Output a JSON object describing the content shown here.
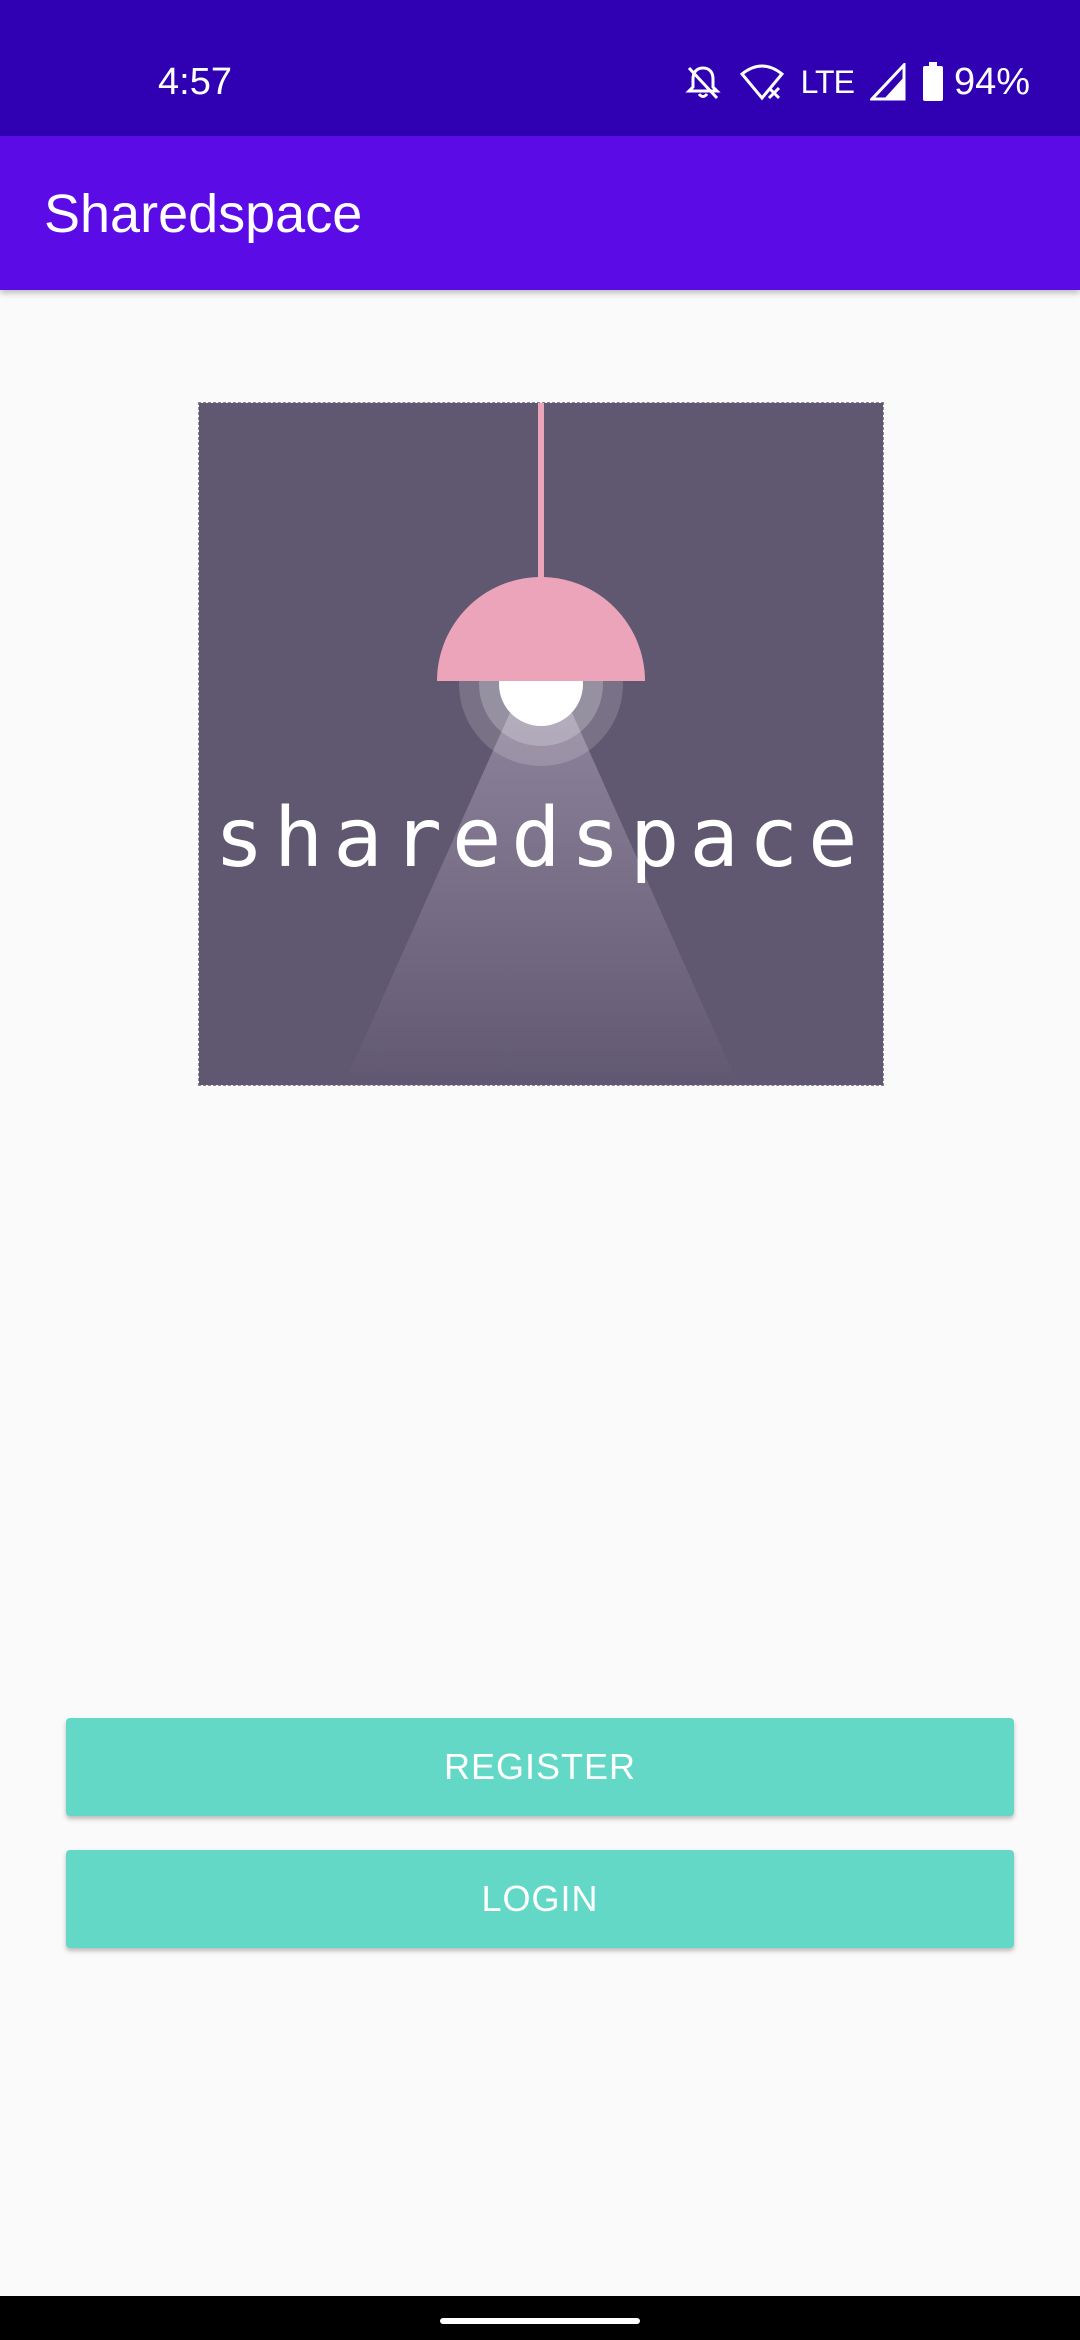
{
  "status": {
    "time": "4:57",
    "network": "LTE",
    "battery": "94%",
    "icons": [
      "notifications-off-icon",
      "wifi-off-icon",
      "signal-icon",
      "battery-icon"
    ]
  },
  "app_bar": {
    "title": "Sharedspace"
  },
  "logo": {
    "wordmark": "sharedspace",
    "background_color": "#605870",
    "lamp_color": "#eba4b9"
  },
  "buttons": {
    "register": "REGISTER",
    "login": "LOGIN"
  },
  "colors": {
    "status_bar": "#3000b3",
    "app_bar": "#5b0be6",
    "button": "#64d8c7"
  }
}
